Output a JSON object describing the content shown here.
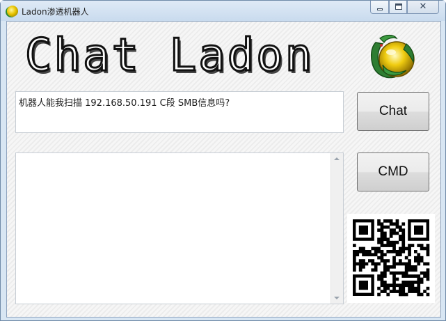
{
  "window": {
    "title": "Ladon渗透机器人",
    "icon": "ladon-dragon-icon",
    "controls": [
      "minimize",
      "maximize",
      "close"
    ]
  },
  "header": {
    "logo_text": "Chat Ladon",
    "logo_image": "ladon-dragon-logo"
  },
  "chat": {
    "input_value": "机器人能我扫描 192.168.50.191 C段 SMB信息吗?",
    "output_value": ""
  },
  "buttons": {
    "chat_label": "Chat",
    "cmd_label": "CMD"
  },
  "qr_code": "qr-code-image",
  "colors": {
    "title_bar": "#c9dbee",
    "client_bg": "#f4f4f4",
    "button_border": "#707070"
  }
}
